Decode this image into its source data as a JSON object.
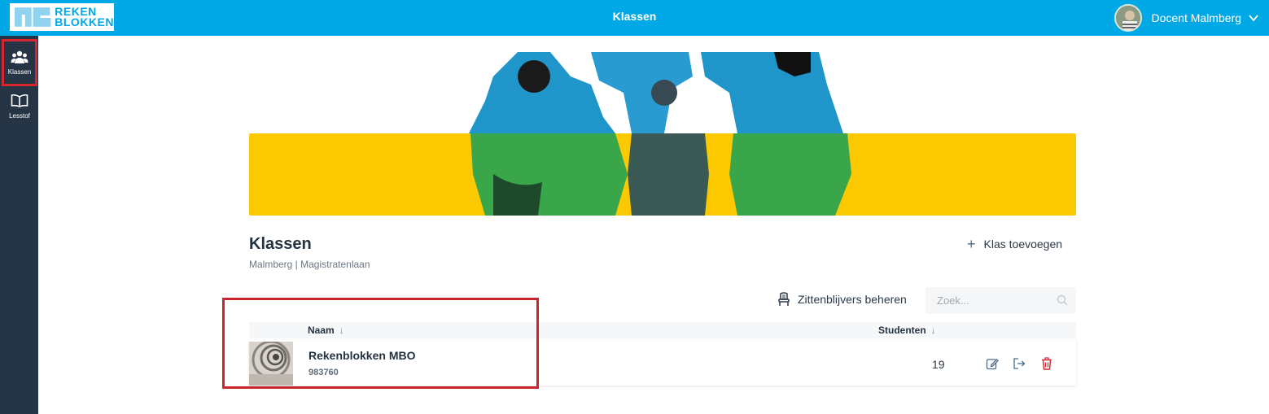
{
  "topbar": {
    "logo_line1": "REKEN",
    "logo_line2": "BLOKKEN",
    "title": "Klassen",
    "user_name": "Docent Malmberg"
  },
  "sidebar": {
    "items": [
      {
        "label": "Klassen",
        "icon": "users-icon",
        "active": true
      },
      {
        "label": "Lesstof",
        "icon": "book-icon",
        "active": false
      }
    ]
  },
  "page": {
    "title": "Klassen",
    "breadcrumb": "Malmberg | Magistratenlaan",
    "add_class_label": "Klas toevoegen",
    "manage_repeaters_label": "Zittenblijvers beheren",
    "search_placeholder": "Zoek..."
  },
  "table": {
    "columns": {
      "name": "Naam",
      "students": "Studenten"
    },
    "rows": [
      {
        "name": "Rekenblokken MBO",
        "code": "983760",
        "students": "19"
      }
    ]
  },
  "colors": {
    "accent": "#00a8e6",
    "sidebar": "#263545",
    "banner_yellow": "#fcc900",
    "delete": "#d6262e"
  }
}
